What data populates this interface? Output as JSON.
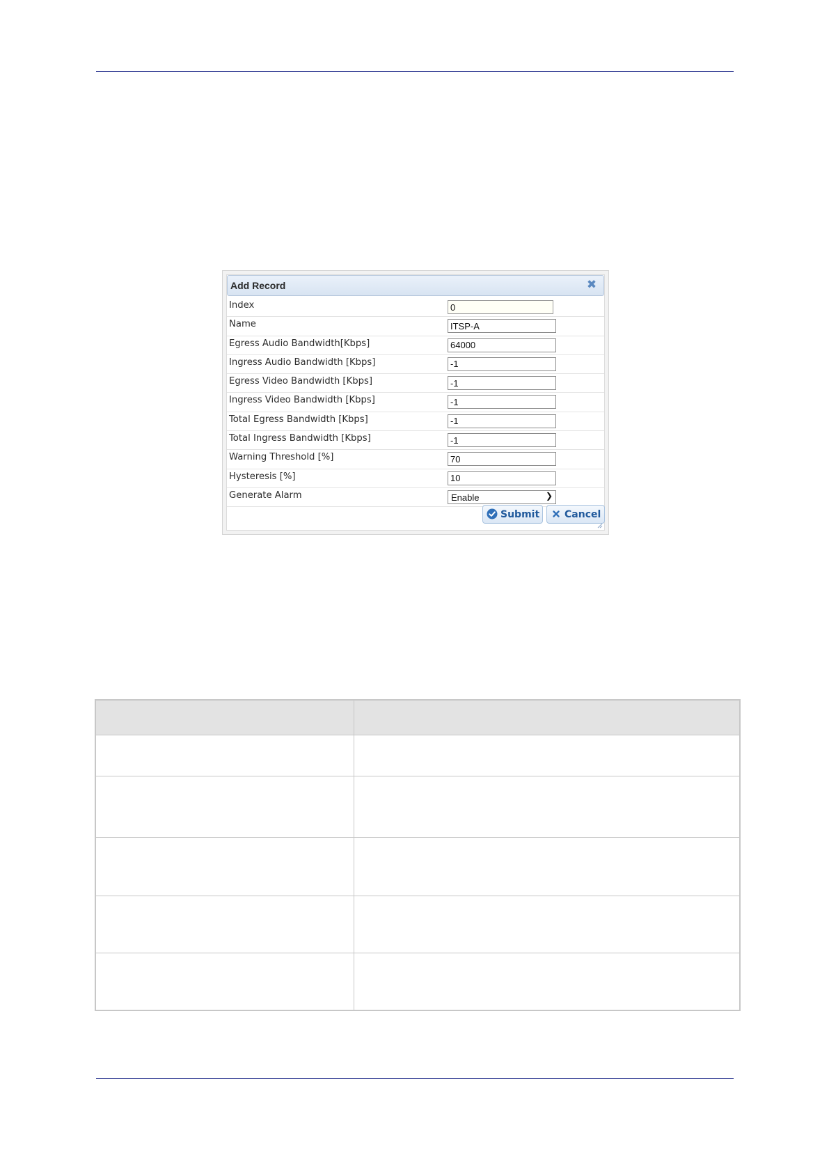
{
  "dialog": {
    "title": "Add Record",
    "fields": [
      {
        "label": "Index",
        "value": "0"
      },
      {
        "label": "Name",
        "value": "ITSP-A"
      },
      {
        "label": "Egress Audio Bandwidth[Kbps]",
        "value": "64000"
      },
      {
        "label": "Ingress Audio Bandwidth [Kbps]",
        "value": "-1"
      },
      {
        "label": "Egress Video Bandwidth [Kbps]",
        "value": "-1"
      },
      {
        "label": "Ingress Video Bandwidth [Kbps]",
        "value": "-1"
      },
      {
        "label": "Total Egress Bandwidth [Kbps]",
        "value": "-1"
      },
      {
        "label": "Total Ingress Bandwidth [Kbps]",
        "value": "-1"
      },
      {
        "label": "Warning Threshold [%]",
        "value": "70"
      },
      {
        "label": "Hysteresis [%]",
        "value": "10"
      },
      {
        "label": "Generate Alarm",
        "value": "Enable"
      }
    ],
    "submit_label": "Submit",
    "cancel_label": "Cancel"
  },
  "colors": {
    "rule": "#1f2a8a",
    "button_text": "#215a9c",
    "table_header_bg": "#e3e3e3"
  }
}
